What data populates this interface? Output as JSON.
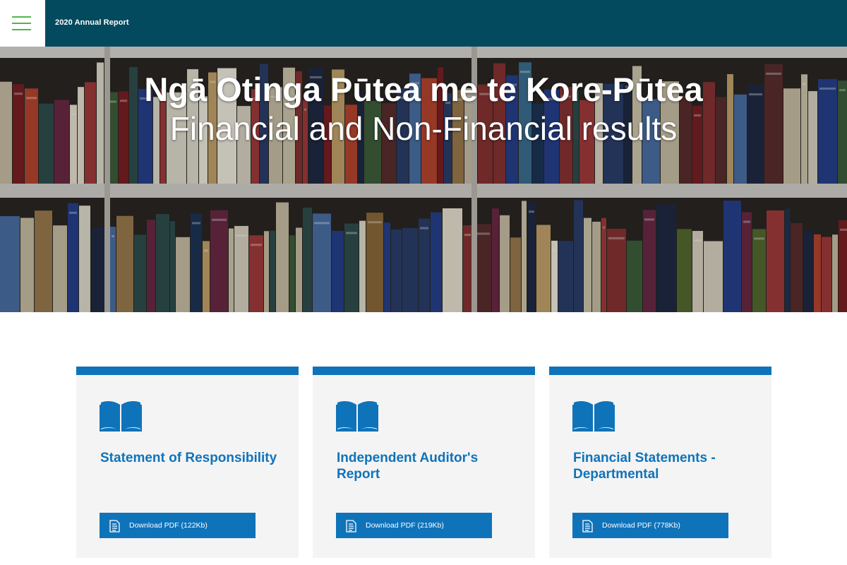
{
  "header": {
    "site_title": "2020 Annual Report",
    "menu_icon": "hamburger-menu-icon"
  },
  "hero": {
    "title": "Ngā Otinga Pūtea me te Kore-Pūtea",
    "subtitle": "Financial and Non-Financial results",
    "background": "bookshelf-photo"
  },
  "cards": [
    {
      "icon": "open-book-icon",
      "title": "Statement of Responsibility",
      "download_label": "Download PDF (122Kb)",
      "download_icon": "pdf-document-icon"
    },
    {
      "icon": "open-book-icon",
      "title": "Independent Auditor's Report",
      "download_label": "Download PDF (219Kb)",
      "download_icon": "pdf-document-icon"
    },
    {
      "icon": "open-book-icon",
      "title": "Financial Statements - Departmental",
      "download_label": "Download PDF (778Kb)",
      "download_icon": "pdf-document-icon"
    }
  ],
  "colors": {
    "header_bg": "#034a5f",
    "accent_blue": "#0f73ba",
    "menu_green": "#4fb748",
    "card_bg": "#f4f4f4"
  }
}
